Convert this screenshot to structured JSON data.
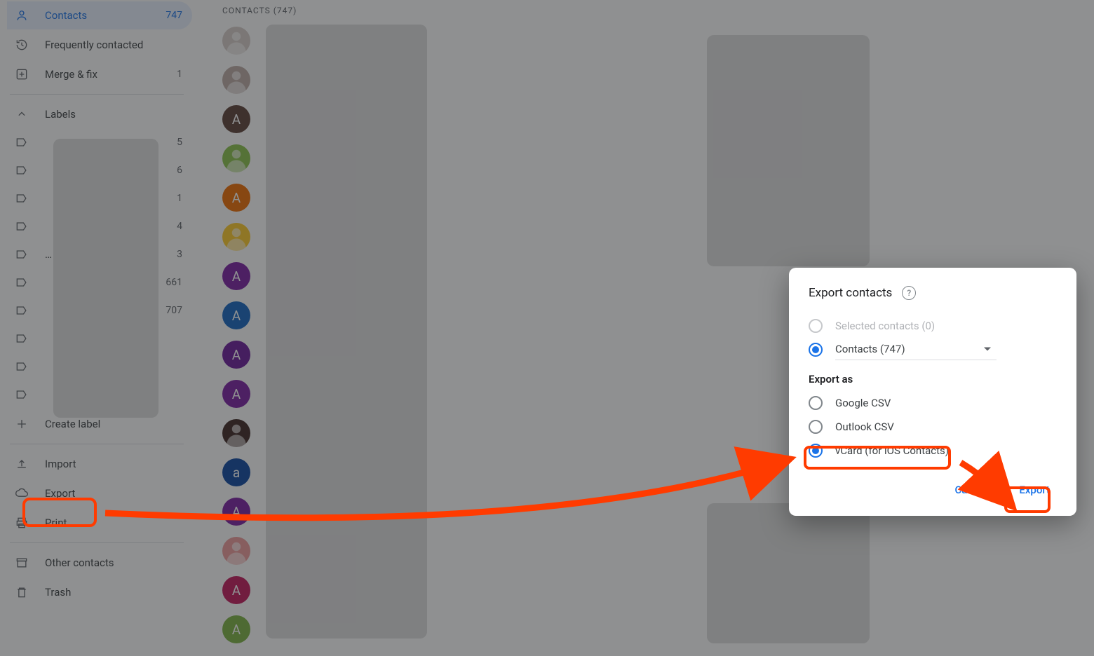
{
  "sidebar": {
    "contacts_label": "Contacts",
    "contacts_count": "747",
    "frequently_label": "Frequently contacted",
    "merge_label": "Merge & fix",
    "merge_count": "1",
    "labels_header": "Labels",
    "labels": [
      {
        "name": "",
        "count": "5"
      },
      {
        "name": "",
        "count": "6"
      },
      {
        "name": "",
        "count": "1"
      },
      {
        "name": "",
        "count": "4"
      },
      {
        "name": "…",
        "count": "3"
      },
      {
        "name": "",
        "count": "661"
      },
      {
        "name": "",
        "count": "707"
      },
      {
        "name": "",
        "count": ""
      },
      {
        "name": "",
        "count": ""
      },
      {
        "name": "",
        "count": ""
      }
    ],
    "create_label": "Create label",
    "import_label": "Import",
    "export_label": "Export",
    "print_label": "Print",
    "other_contacts_label": "Other contacts",
    "trash_label": "Trash"
  },
  "main": {
    "section_header": "CONTACTS (747)",
    "avatars": [
      {
        "text": "",
        "bg": "#d7ccc8",
        "img": true
      },
      {
        "text": "",
        "bg": "#bcaaa4",
        "img": true
      },
      {
        "text": "A",
        "bg": "#5d4037"
      },
      {
        "text": "",
        "bg": "#8bc34a",
        "img": true
      },
      {
        "text": "A",
        "bg": "#ef6c00"
      },
      {
        "text": "",
        "bg": "#ffca28",
        "img": true
      },
      {
        "text": "A",
        "bg": "#7b1fa2"
      },
      {
        "text": "A",
        "bg": "#1565c0"
      },
      {
        "text": "A",
        "bg": "#6a1b9a"
      },
      {
        "text": "A",
        "bg": "#7b1fa2"
      },
      {
        "text": "",
        "bg": "#3e2723",
        "img": true
      },
      {
        "text": "a",
        "bg": "#0d47a1"
      },
      {
        "text": "A",
        "bg": "#7b1fa2"
      },
      {
        "text": "",
        "bg": "#ef9a9a",
        "img": true
      },
      {
        "text": "A",
        "bg": "#c2185b"
      },
      {
        "text": "A",
        "bg": "#7cb342"
      }
    ]
  },
  "dialog": {
    "title": "Export contacts",
    "opt_selected_disabled": "Selected contacts (0)",
    "opt_all": "Contacts (747)",
    "export_as_label": "Export as",
    "fmt_google": "Google CSV",
    "fmt_outlook": "Outlook CSV",
    "fmt_vcard": "vCard (for iOS Contacts)",
    "cancel": "Cancel",
    "export": "Export"
  }
}
